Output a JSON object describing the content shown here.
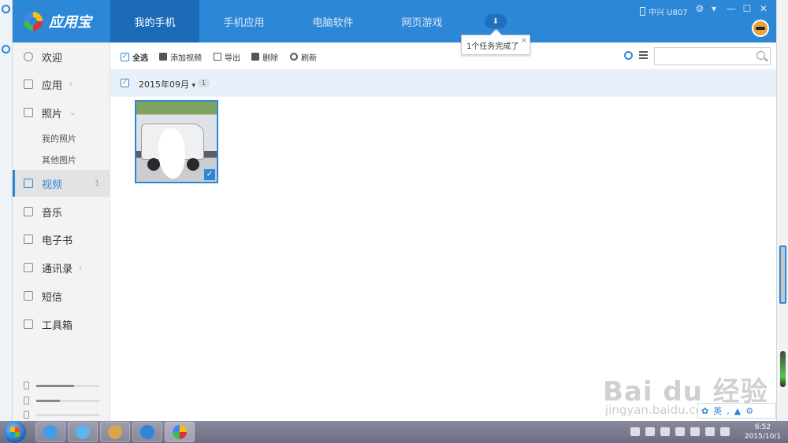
{
  "app": {
    "name": "应用宝"
  },
  "tabs": [
    {
      "label": "我的手机",
      "active": true
    },
    {
      "label": "手机应用"
    },
    {
      "label": "电脑软件"
    },
    {
      "label": "网页游戏"
    }
  ],
  "notification": {
    "text": "1个任务完成了",
    "close": "×"
  },
  "device": {
    "name": "中兴 U807"
  },
  "window_controls": [
    "⚙",
    "▾",
    "—",
    "☐",
    "✕"
  ],
  "sidebar": {
    "items": [
      {
        "label": "欢迎",
        "icon": "welcome-icon"
      },
      {
        "label": "应用",
        "icon": "apps-grid-icon",
        "chevron": "›"
      },
      {
        "label": "照片",
        "icon": "photo-icon",
        "chevron": "⌄"
      },
      {
        "label": "视频",
        "icon": "video-icon",
        "count": "1",
        "active": true
      },
      {
        "label": "音乐",
        "icon": "music-icon"
      },
      {
        "label": "电子书",
        "icon": "ebook-icon"
      },
      {
        "label": "通讯录",
        "icon": "contacts-icon",
        "chevron": "›"
      },
      {
        "label": "短信",
        "icon": "sms-icon"
      },
      {
        "label": "工具箱",
        "icon": "toolbox-icon"
      }
    ],
    "photo_sub": [
      "我的照片",
      "其他图片"
    ],
    "storage_fill": [
      0.6,
      0.38,
      0.0
    ]
  },
  "toolbar": {
    "select_all": "全选",
    "add_video": "添加视频",
    "export": "导出",
    "delete": "删除",
    "refresh": "刷新"
  },
  "search": {
    "placeholder": ""
  },
  "group": {
    "date": "2015年09月",
    "caret": "▾",
    "count": "1"
  },
  "videos": [
    {
      "selected": true
    }
  ],
  "watermark": {
    "brand": "Bai du 经验",
    "url": "jingyan.baidu.com"
  },
  "ime": {
    "label": "英"
  },
  "clock": {
    "time": "6:52",
    "date": "2015/10/1"
  },
  "colors": {
    "accent": "#2d87d7",
    "accent_dark": "#1c6bb8"
  }
}
